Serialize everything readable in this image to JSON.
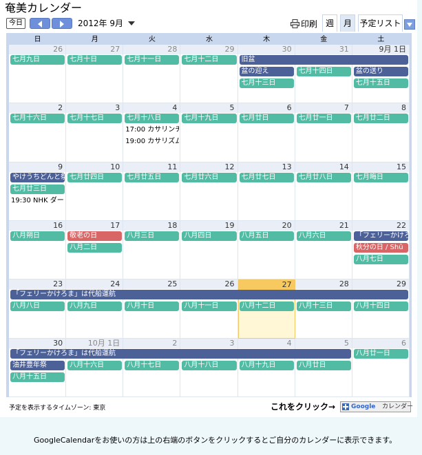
{
  "app_title": "奄美カレンダー",
  "toolbar": {
    "today_label": "今日",
    "month_label": "2012年 9月",
    "print_label": "印刷",
    "tabs": [
      {
        "label": "週",
        "active": false
      },
      {
        "label": "月",
        "active": true
      },
      {
        "label": "予定リスト",
        "active": false
      }
    ]
  },
  "weekdays": [
    "日",
    "月",
    "火",
    "水",
    "木",
    "金",
    "土"
  ],
  "weeks": [
    {
      "days": [
        {
          "label": "26",
          "other": true
        },
        {
          "label": "27",
          "other": true
        },
        {
          "label": "28",
          "other": true
        },
        {
          "label": "29",
          "other": true
        },
        {
          "label": "30",
          "other": true
        },
        {
          "label": "31",
          "other": true
        },
        {
          "label": "9月 1日",
          "other": false
        }
      ],
      "events": [
        {
          "col": 0,
          "span": 1,
          "row": 0,
          "text": "七月九日",
          "color": "teal"
        },
        {
          "col": 1,
          "span": 1,
          "row": 0,
          "text": "七月十日",
          "color": "teal"
        },
        {
          "col": 2,
          "span": 1,
          "row": 0,
          "text": "七月十一日",
          "color": "teal"
        },
        {
          "col": 3,
          "span": 1,
          "row": 0,
          "text": "七月十二日",
          "color": "teal"
        },
        {
          "col": 4,
          "span": 3,
          "row": 0,
          "text": "旧盆",
          "color": "navy"
        },
        {
          "col": 4,
          "span": 1,
          "row": 1,
          "text": "盆の迎え",
          "color": "navy"
        },
        {
          "col": 5,
          "span": 1,
          "row": 1,
          "text": "七月十四日",
          "color": "teal"
        },
        {
          "col": 6,
          "span": 1,
          "row": 1,
          "text": "盆の送り",
          "color": "navy"
        },
        {
          "col": 4,
          "span": 1,
          "row": 2,
          "text": "七月十三日",
          "color": "teal"
        },
        {
          "col": 6,
          "span": 1,
          "row": 2,
          "text": "七月十五日",
          "color": "teal"
        }
      ],
      "texts": []
    },
    {
      "days": [
        {
          "label": "2",
          "other": false
        },
        {
          "label": "3",
          "other": false
        },
        {
          "label": "4",
          "other": false
        },
        {
          "label": "5",
          "other": false
        },
        {
          "label": "6",
          "other": false
        },
        {
          "label": "7",
          "other": false
        },
        {
          "label": "8",
          "other": false
        }
      ],
      "events": [
        {
          "col": 0,
          "span": 1,
          "row": 0,
          "text": "七月十六日",
          "color": "teal"
        },
        {
          "col": 1,
          "span": 1,
          "row": 0,
          "text": "七月十七日",
          "color": "teal"
        },
        {
          "col": 2,
          "span": 1,
          "row": 0,
          "text": "七月十八日",
          "color": "teal"
        },
        {
          "col": 3,
          "span": 1,
          "row": 0,
          "text": "七月十九日",
          "color": "teal"
        },
        {
          "col": 4,
          "span": 1,
          "row": 0,
          "text": "七月廿日",
          "color": "teal"
        },
        {
          "col": 5,
          "span": 1,
          "row": 0,
          "text": "七月廿一日",
          "color": "teal"
        },
        {
          "col": 6,
          "span": 1,
          "row": 0,
          "text": "七月廿二日",
          "color": "teal"
        }
      ],
      "texts": [
        {
          "col": 2,
          "row": 1,
          "text": "17:00 カサリンチ"
        },
        {
          "col": 2,
          "row": 2,
          "text": "19:00 カサリズム"
        }
      ]
    },
    {
      "days": [
        {
          "label": "9",
          "other": false
        },
        {
          "label": "10",
          "other": false
        },
        {
          "label": "11",
          "other": false
        },
        {
          "label": "12",
          "other": false
        },
        {
          "label": "13",
          "other": false
        },
        {
          "label": "14",
          "other": false
        },
        {
          "label": "15",
          "other": false
        }
      ],
      "events": [
        {
          "col": 0,
          "span": 1,
          "row": 0,
          "text": "やけうちどんと祭",
          "color": "navy"
        },
        {
          "col": 1,
          "span": 1,
          "row": 0,
          "text": "七月廿四日",
          "color": "teal"
        },
        {
          "col": 2,
          "span": 1,
          "row": 0,
          "text": "七月廿五日",
          "color": "teal"
        },
        {
          "col": 3,
          "span": 1,
          "row": 0,
          "text": "七月廿六日",
          "color": "teal"
        },
        {
          "col": 4,
          "span": 1,
          "row": 0,
          "text": "七月廿七日",
          "color": "teal"
        },
        {
          "col": 5,
          "span": 1,
          "row": 0,
          "text": "七月廿八日",
          "color": "teal"
        },
        {
          "col": 6,
          "span": 1,
          "row": 0,
          "text": "七月晦日",
          "color": "teal"
        },
        {
          "col": 0,
          "span": 1,
          "row": 1,
          "text": "七月廿三日",
          "color": "teal"
        }
      ],
      "texts": [
        {
          "col": 0,
          "row": 2,
          "text": "19:30 NHK ダー"
        }
      ]
    },
    {
      "days": [
        {
          "label": "16",
          "other": false
        },
        {
          "label": "17",
          "other": false
        },
        {
          "label": "18",
          "other": false
        },
        {
          "label": "19",
          "other": false
        },
        {
          "label": "20",
          "other": false
        },
        {
          "label": "21",
          "other": false
        },
        {
          "label": "22",
          "other": false
        }
      ],
      "events": [
        {
          "col": 0,
          "span": 1,
          "row": 0,
          "text": "八月朔日",
          "color": "teal"
        },
        {
          "col": 1,
          "span": 1,
          "row": 0,
          "text": "敬老の日",
          "color": "red"
        },
        {
          "col": 2,
          "span": 1,
          "row": 0,
          "text": "八月三日",
          "color": "teal"
        },
        {
          "col": 3,
          "span": 1,
          "row": 0,
          "text": "八月四日",
          "color": "teal"
        },
        {
          "col": 4,
          "span": 1,
          "row": 0,
          "text": "八月五日",
          "color": "teal"
        },
        {
          "col": 5,
          "span": 1,
          "row": 0,
          "text": "八月六日",
          "color": "teal"
        },
        {
          "col": 6,
          "span": 1,
          "row": 0,
          "text": "「フェリーかけろま",
          "color": "navy"
        },
        {
          "col": 1,
          "span": 1,
          "row": 1,
          "text": "八月二日",
          "color": "teal"
        },
        {
          "col": 6,
          "span": 1,
          "row": 1,
          "text": "秋分の日 / Shū",
          "color": "red"
        },
        {
          "col": 6,
          "span": 1,
          "row": 2,
          "text": "八月七日",
          "color": "teal"
        }
      ],
      "texts": []
    },
    {
      "days": [
        {
          "label": "23",
          "other": false
        },
        {
          "label": "24",
          "other": false
        },
        {
          "label": "25",
          "other": false
        },
        {
          "label": "26",
          "other": false
        },
        {
          "label": "27",
          "other": false,
          "today": true
        },
        {
          "label": "28",
          "other": false
        },
        {
          "label": "29",
          "other": false
        }
      ],
      "events": [
        {
          "col": 0,
          "span": 7,
          "row": 0,
          "text": "「フェリーかけろま」は代船運航",
          "color": "navy"
        },
        {
          "col": 0,
          "span": 1,
          "row": 1,
          "text": "八月八日",
          "color": "teal"
        },
        {
          "col": 1,
          "span": 1,
          "row": 1,
          "text": "八月九日",
          "color": "teal"
        },
        {
          "col": 2,
          "span": 1,
          "row": 1,
          "text": "八月十日",
          "color": "teal"
        },
        {
          "col": 3,
          "span": 1,
          "row": 1,
          "text": "八月十一日",
          "color": "teal"
        },
        {
          "col": 4,
          "span": 1,
          "row": 1,
          "text": "八月十二日",
          "color": "teal"
        },
        {
          "col": 5,
          "span": 1,
          "row": 1,
          "text": "八月十三日",
          "color": "teal"
        },
        {
          "col": 6,
          "span": 1,
          "row": 1,
          "text": "八月十四日",
          "color": "teal"
        }
      ],
      "texts": []
    },
    {
      "days": [
        {
          "label": "30",
          "other": false
        },
        {
          "label": "10月 1日",
          "other": true
        },
        {
          "label": "2",
          "other": true
        },
        {
          "label": "3",
          "other": true
        },
        {
          "label": "4",
          "other": true
        },
        {
          "label": "5",
          "other": true
        },
        {
          "label": "6",
          "other": true
        }
      ],
      "events": [
        {
          "col": 0,
          "span": 6,
          "row": 0,
          "text": "「フェリーかけろま」は代船運航",
          "color": "navy"
        },
        {
          "col": 6,
          "span": 1,
          "row": 0,
          "text": "八月廿一日",
          "color": "teal"
        },
        {
          "col": 0,
          "span": 1,
          "row": 1,
          "text": "油井豊年祭",
          "color": "navy"
        },
        {
          "col": 1,
          "span": 1,
          "row": 1,
          "text": "八月十六日",
          "color": "teal"
        },
        {
          "col": 2,
          "span": 1,
          "row": 1,
          "text": "八月十七日",
          "color": "teal"
        },
        {
          "col": 3,
          "span": 1,
          "row": 1,
          "text": "八月十八日",
          "color": "teal"
        },
        {
          "col": 4,
          "span": 1,
          "row": 1,
          "text": "八月十九日",
          "color": "teal"
        },
        {
          "col": 5,
          "span": 1,
          "row": 1,
          "text": "八月廿日",
          "color": "teal"
        },
        {
          "col": 0,
          "span": 1,
          "row": 2,
          "text": "八月十五日",
          "color": "teal"
        }
      ],
      "texts": []
    }
  ],
  "footer": {
    "timezone": "予定を表示するタイムゾーン: 東京",
    "click_hint": "これをクリック→",
    "gcal_button_g": "Google",
    "gcal_button_label": "カレンダー"
  },
  "bottom_note": "GoogleCalendarをお使いの方は上の右端のボタンをクリックするとご自分のカレンダーに表示できます。",
  "colors": {
    "teal": "#52bba3",
    "navy": "#4d6199",
    "red": "#d96666",
    "today": "#f7c95e"
  },
  "icons": {
    "prev": "left-arrow-icon",
    "next": "right-arrow-icon",
    "print": "printer-icon",
    "dropdown": "caret-down-icon"
  }
}
